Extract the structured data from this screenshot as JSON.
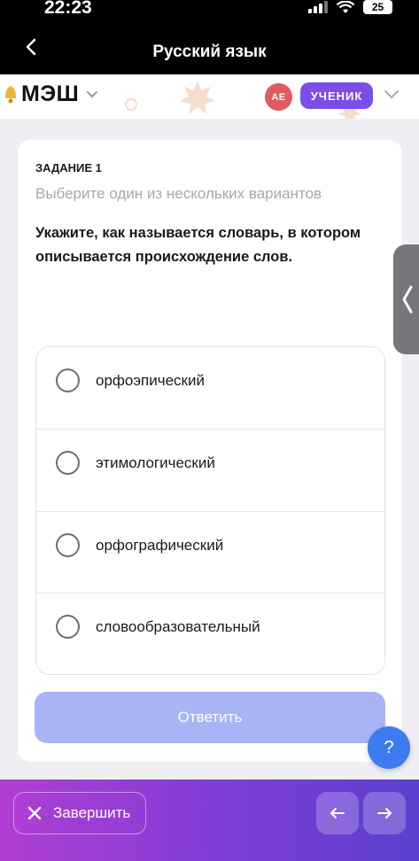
{
  "status_bar": {
    "time": "22:23",
    "battery": "25"
  },
  "nav": {
    "title": "Русский язык"
  },
  "header": {
    "logo_text": "МЭШ",
    "avatar_initials": "АЕ",
    "role": "УЧЕНИК"
  },
  "task": {
    "number_label": "ЗАДАНИЕ 1",
    "hint": "Выберите один из нескольких вариантов",
    "question": "Укажите, как называется словарь, в котором описывается происхождение слов.",
    "options": [
      {
        "label": "орфоэпический"
      },
      {
        "label": "этимологический"
      },
      {
        "label": "орфографический"
      },
      {
        "label": "словообразовательный"
      }
    ],
    "answer_button": "Ответить"
  },
  "help": {
    "label": "?"
  },
  "bottom_bar": {
    "finish_label": "Завершить"
  },
  "colors": {
    "accent": "#7b4ee8",
    "answer_disabled": "#a9b4f6",
    "help": "#3d7cf0"
  }
}
